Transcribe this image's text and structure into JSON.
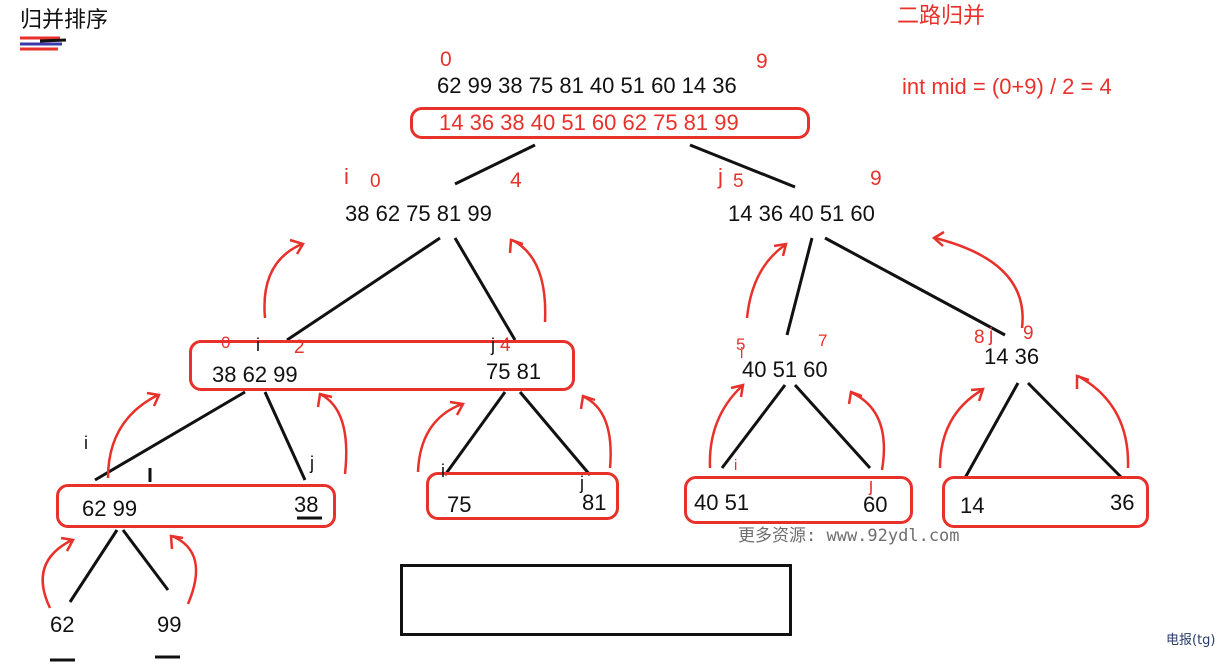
{
  "header": {
    "title": "归并排序",
    "subtitle": "二路归并",
    "formula": "int mid = (0+9) / 2 = 4"
  },
  "root": {
    "left_index": "0",
    "right_index": "9",
    "unsorted": "62 99 38 75 81 40 51 60 14 36",
    "sorted": "14 36 38 40 51 60 62 75 81 99"
  },
  "level1": {
    "left": {
      "marks": [
        "i",
        "0",
        "4"
      ],
      "values": "38  62  75  81  99"
    },
    "right": {
      "marks": [
        "j",
        "5",
        "9"
      ],
      "values": "14 36 40 51 60"
    }
  },
  "level2": {
    "n1": {
      "marks": [
        "0",
        "i",
        "2",
        "j",
        "4"
      ],
      "left_values": "38 62 99",
      "right_values": "75  81"
    },
    "n2": {
      "marks": [
        "5",
        "i",
        "7"
      ],
      "values": "40  51  60"
    },
    "n3": {
      "marks": [
        "8",
        "j",
        "9"
      ],
      "values": "14 36"
    }
  },
  "level3": {
    "a": {
      "marks": [
        "i",
        "j"
      ],
      "left_values": "62  99",
      "right_value": "38"
    },
    "b": {
      "marks": [
        "i",
        "j"
      ],
      "left_value": "75",
      "right_value": "81"
    },
    "c": {
      "marks": [
        "i",
        "j"
      ],
      "left_value": "40 51",
      "right_value": "60"
    },
    "d": {
      "left_value": "14",
      "right_value": "36"
    }
  },
  "level4": {
    "left_value": "62",
    "right_value": "99"
  },
  "watermark": "更多资源: www.92ydl.com",
  "corner_note": "电报(tg)",
  "colors": {
    "ink": "#111111",
    "annotation": "#e8312b"
  }
}
